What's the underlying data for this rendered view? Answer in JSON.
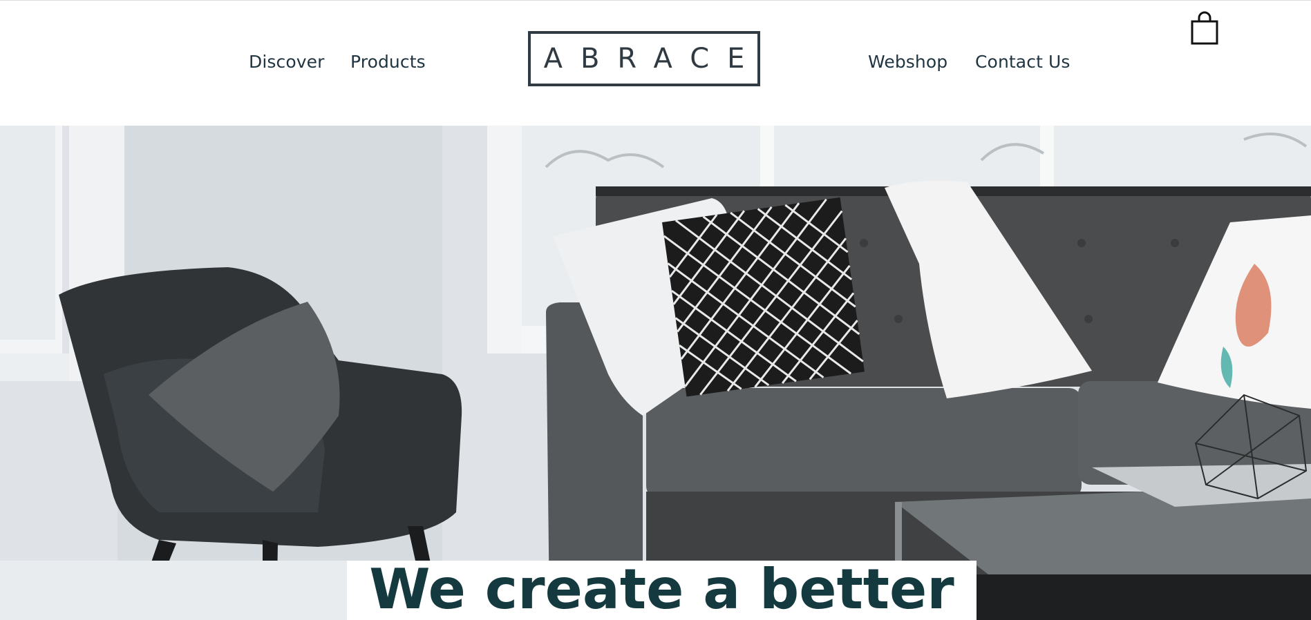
{
  "brand": {
    "logo_text": "ABRACE"
  },
  "nav": {
    "left": [
      {
        "label": "Discover"
      },
      {
        "label": "Products"
      }
    ],
    "right": [
      {
        "label": "Webshop"
      },
      {
        "label": "Contact Us"
      }
    ]
  },
  "header": {
    "cart_icon": "shopping-bag-icon"
  },
  "hero": {
    "headline": "We create a better",
    "image": "living-room-scene"
  },
  "colors": {
    "nav_text": "#1f3440",
    "logo": "#2f3a42",
    "headline": "#143a40"
  }
}
